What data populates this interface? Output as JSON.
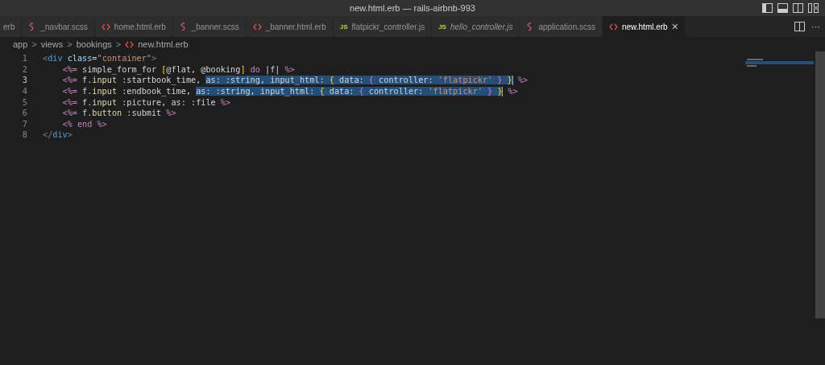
{
  "window": {
    "title": "new.html.erb — rails-airbnb-993"
  },
  "tabs": [
    {
      "label": "erb",
      "kind": "plain",
      "selected": false,
      "preview": false
    },
    {
      "label": "_navbar.scss",
      "kind": "style",
      "selected": false,
      "preview": false
    },
    {
      "label": "home.html.erb",
      "kind": "markup",
      "selected": false,
      "preview": false
    },
    {
      "label": "_banner.scss",
      "kind": "style",
      "selected": false,
      "preview": false
    },
    {
      "label": "_banner.html.erb",
      "kind": "markup",
      "selected": false,
      "preview": false
    },
    {
      "label": "flatpickr_controller.js",
      "kind": "script",
      "badge": "JS",
      "selected": false,
      "preview": false
    },
    {
      "label": "hello_controller.js",
      "kind": "script",
      "badge": "JS",
      "selected": false,
      "preview": true
    },
    {
      "label": "application.scss",
      "kind": "style",
      "selected": false,
      "preview": false
    },
    {
      "label": "new.html.erb",
      "kind": "markup",
      "selected": true,
      "preview": false
    }
  ],
  "close_glyph": "×",
  "more_glyph": "···",
  "breadcrumbs": [
    {
      "label": "app",
      "kind": "plain"
    },
    {
      "label": "views",
      "kind": "plain"
    },
    {
      "label": "bookings",
      "kind": "plain"
    },
    {
      "label": "new.html.erb",
      "kind": "markup"
    }
  ],
  "breadcrumb_separator": ">",
  "lines": [
    {
      "number": "1",
      "active": false,
      "cursor": false,
      "tokens": [
        {
          "text": "<",
          "kind": "punct"
        },
        {
          "text": "div",
          "kind": "tag"
        },
        {
          "text": " class",
          "kind": "attr"
        },
        {
          "text": "=",
          "kind": "plain"
        },
        {
          "text": "\"container\"",
          "kind": "string"
        },
        {
          "text": ">",
          "kind": "punct"
        }
      ]
    },
    {
      "number": "2",
      "active": false,
      "cursor": false,
      "tokens": [
        {
          "text": "    <%=",
          "kind": "erb"
        },
        {
          "text": " simple_form_for ",
          "kind": "plain"
        },
        {
          "text": "[",
          "kind": "bracket"
        },
        {
          "text": "@flat, @booking",
          "kind": "plain"
        },
        {
          "text": "]",
          "kind": "bracket"
        },
        {
          "text": " do ",
          "kind": "keyword"
        },
        {
          "text": "|f|",
          "kind": "plain"
        },
        {
          "text": " %>",
          "kind": "erb"
        }
      ]
    },
    {
      "number": "3",
      "active": true,
      "cursor": true,
      "tokens": [
        {
          "text": "    <%=",
          "kind": "erb"
        },
        {
          "text": " f.",
          "kind": "plain"
        },
        {
          "text": "input",
          "kind": "method"
        },
        {
          "text": " :startbook_time, ",
          "kind": "plain"
        }
      ],
      "selection": [
        {
          "text": "as: :string, input_html: ",
          "kind": "plain"
        },
        {
          "text": "{",
          "kind": "bracket"
        },
        {
          "text": " data: ",
          "kind": "plain"
        },
        {
          "text": "{",
          "kind": "bracket2"
        },
        {
          "text": " controller: ",
          "kind": "plain"
        },
        {
          "text": "'flatpickr'",
          "kind": "string"
        },
        {
          "text": " }",
          "kind": "bracket2"
        },
        {
          "text": " }",
          "kind": "bracket"
        }
      ],
      "tail": [
        {
          "text": " %>",
          "kind": "erb"
        }
      ]
    },
    {
      "number": "4",
      "active": false,
      "cursor": true,
      "tokens": [
        {
          "text": "    <%=",
          "kind": "erb"
        },
        {
          "text": " f.",
          "kind": "plain"
        },
        {
          "text": "input",
          "kind": "method"
        },
        {
          "text": " :endbook_time, ",
          "kind": "plain"
        }
      ],
      "selection": [
        {
          "text": "as: :string, input_html: ",
          "kind": "plain"
        },
        {
          "text": "{",
          "kind": "bracket"
        },
        {
          "text": " data: ",
          "kind": "plain"
        },
        {
          "text": "{",
          "kind": "bracket2"
        },
        {
          "text": " controller: ",
          "kind": "plain"
        },
        {
          "text": "'flatpickr'",
          "kind": "string"
        },
        {
          "text": " }",
          "kind": "bracket2"
        },
        {
          "text": " }",
          "kind": "bracket"
        }
      ],
      "tail": [
        {
          "text": " %>",
          "kind": "erb"
        }
      ]
    },
    {
      "number": "5",
      "active": false,
      "cursor": false,
      "tokens": [
        {
          "text": "    <%=",
          "kind": "erb"
        },
        {
          "text": " f.",
          "kind": "plain"
        },
        {
          "text": "input",
          "kind": "method"
        },
        {
          "text": " :picture, as: :file",
          "kind": "plain"
        },
        {
          "text": " %>",
          "kind": "erb"
        }
      ]
    },
    {
      "number": "6",
      "active": false,
      "cursor": false,
      "tokens": [
        {
          "text": "    <%=",
          "kind": "erb"
        },
        {
          "text": " f.",
          "kind": "plain"
        },
        {
          "text": "button",
          "kind": "method"
        },
        {
          "text": " :submit",
          "kind": "plain"
        },
        {
          "text": " %>",
          "kind": "erb"
        }
      ]
    },
    {
      "number": "7",
      "active": false,
      "cursor": false,
      "tokens": [
        {
          "text": "    <%",
          "kind": "erb"
        },
        {
          "text": " end",
          "kind": "keyword"
        },
        {
          "text": " %>",
          "kind": "erb"
        }
      ]
    },
    {
      "number": "8",
      "active": false,
      "cursor": false,
      "tokens": [
        {
          "text": "</",
          "kind": "punct"
        },
        {
          "text": "div",
          "kind": "tag"
        },
        {
          "text": ">",
          "kind": "punct"
        }
      ]
    }
  ]
}
